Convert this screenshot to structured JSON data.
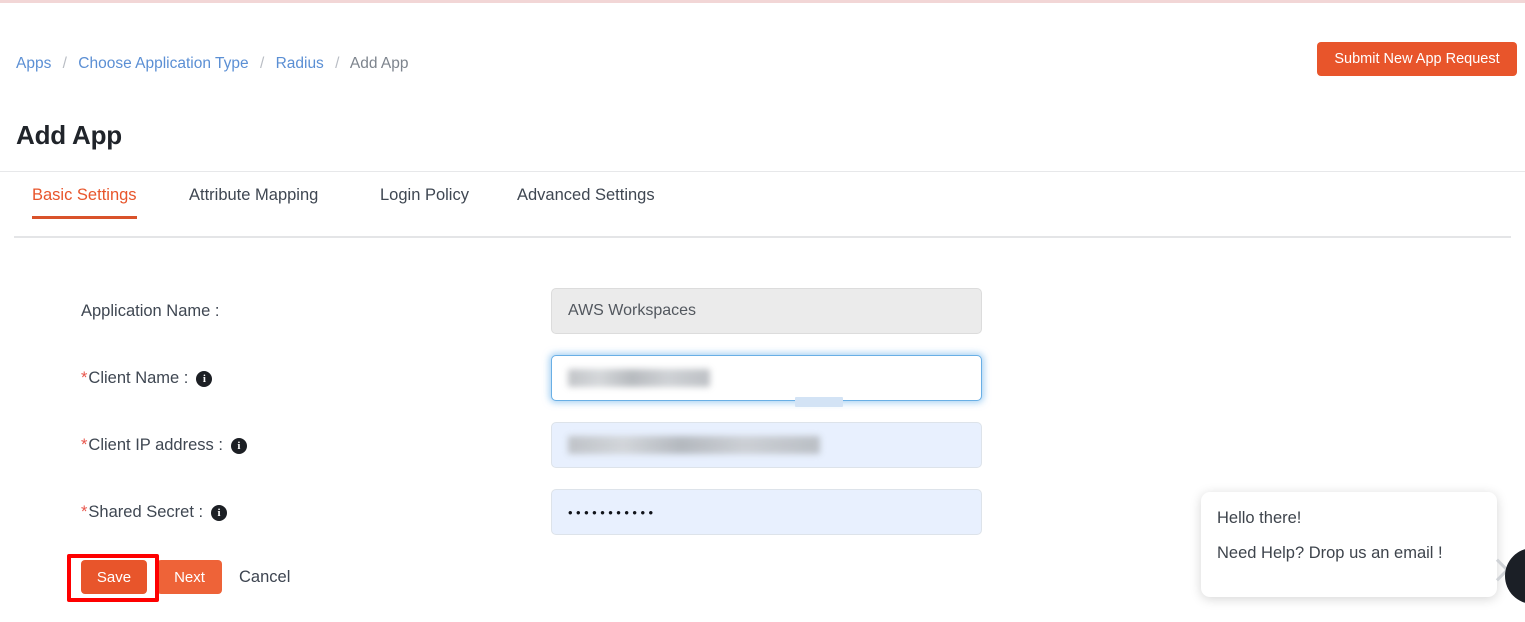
{
  "header": {
    "breadcrumb": [
      {
        "label": "Apps",
        "type": "link"
      },
      {
        "label": "Choose Application Type",
        "type": "link"
      },
      {
        "label": "Radius",
        "type": "link"
      },
      {
        "label": "Add App",
        "type": "current"
      }
    ],
    "separator": "/",
    "page_title": "Add App",
    "submit_request_label": "Submit New App Request"
  },
  "tabs": [
    {
      "label": "Basic Settings",
      "active": true
    },
    {
      "label": "Attribute Mapping",
      "active": false
    },
    {
      "label": "Login Policy",
      "active": false
    },
    {
      "label": "Advanced Settings",
      "active": false
    }
  ],
  "form": {
    "fields": [
      {
        "label": "Application Name :",
        "required": false,
        "has_info_icon": false,
        "value": "AWS Workspaces",
        "state": "disabled"
      },
      {
        "label": "Client Name :",
        "required": true,
        "has_info_icon": true,
        "value": "",
        "state": "focused-redacted"
      },
      {
        "label": "Client IP address :",
        "required": true,
        "has_info_icon": true,
        "value": "",
        "state": "autofilled-redacted"
      },
      {
        "label": "Shared Secret :",
        "required": true,
        "has_info_icon": true,
        "value": "•••••••••••",
        "state": "masked"
      }
    ],
    "required_marker": "*",
    "info_icon_glyph": "i"
  },
  "actions": {
    "save_label": "Save",
    "next_label": "Next",
    "cancel_label": "Cancel",
    "save_highlighted": true
  },
  "chat": {
    "greeting": "Hello there!",
    "prompt": "Need Help? Drop us an email !"
  },
  "colors": {
    "accent_orange": "#e8552b",
    "next_orange": "#ee6338",
    "link_blue": "#5b8fd4",
    "required_red": "#e8554b",
    "highlight_red": "#fe0000",
    "focus_blue": "#69afe5",
    "autofill_blue": "#e8f0fe",
    "disabled_gray": "#ebebeb",
    "chat_dark": "#1b1f26"
  }
}
